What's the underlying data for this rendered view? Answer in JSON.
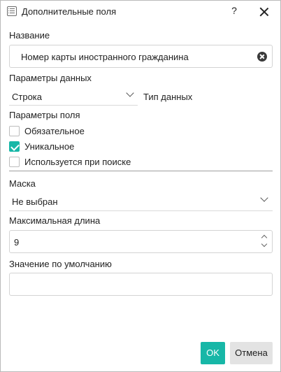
{
  "window": {
    "title": "Дополнительные поля",
    "help_label": "?",
    "icon": "list-icon",
    "close_icon": "close-icon"
  },
  "name": {
    "label": "Название",
    "value": "Номер карты иностранного гражданина",
    "clear_icon": "clear-circle-icon"
  },
  "data_params": {
    "label": "Параметры данных",
    "type_value": "Строка",
    "type_caption": "Тип данных"
  },
  "field_params": {
    "label": "Параметры поля",
    "options": [
      {
        "label": "Обязательное",
        "checked": false
      },
      {
        "label": "Уникальное",
        "checked": true
      },
      {
        "label": "Используется при поиске",
        "checked": false
      }
    ]
  },
  "mask": {
    "label": "Маска",
    "value": "Не выбран"
  },
  "max_length": {
    "label": "Максимальная длина",
    "value": "9"
  },
  "default_value": {
    "label": "Значение по умолчанию",
    "value": ""
  },
  "buttons": {
    "ok": "OK",
    "cancel": "Отмена"
  },
  "colors": {
    "accent": "#17b7a7",
    "cancel_bg": "#e3e3e3",
    "border": "#d3d3d3"
  }
}
